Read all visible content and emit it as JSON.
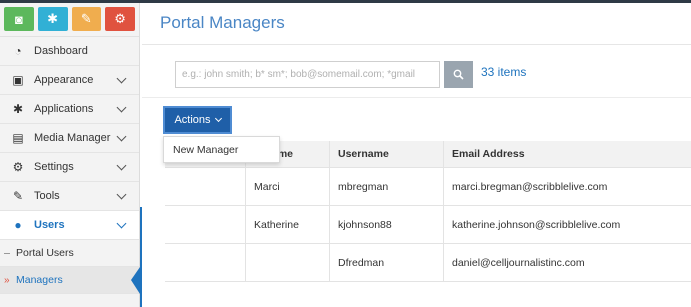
{
  "quick_buttons": [
    {
      "icon": "camera-icon",
      "color": "#5cb85c",
      "glyph": "◙"
    },
    {
      "icon": "asterisk-icon",
      "color": "#31b0d5",
      "glyph": "✱"
    },
    {
      "icon": "wrench-icon",
      "color": "#f0ad4e",
      "glyph": "✎"
    },
    {
      "icon": "cogs-icon",
      "color": "#e0523f",
      "glyph": "⚙"
    }
  ],
  "sidebar": {
    "items": [
      {
        "label": "Dashboard",
        "icon": "dashboard-icon",
        "glyph": "◔"
      },
      {
        "label": "Appearance",
        "icon": "picture-icon",
        "glyph": "▣"
      },
      {
        "label": "Applications",
        "icon": "asterisk-icon",
        "glyph": "✱"
      },
      {
        "label": "Media Manager",
        "icon": "film-icon",
        "glyph": "▤"
      },
      {
        "label": "Settings",
        "icon": "cogs-icon",
        "glyph": "⚙"
      },
      {
        "label": "Tools",
        "icon": "wrench-icon",
        "glyph": "✎"
      },
      {
        "label": "Users",
        "icon": "user-icon",
        "glyph": "●"
      }
    ],
    "sub_items": [
      {
        "label": "Portal Users"
      },
      {
        "label": "Managers",
        "arrow": "»"
      }
    ]
  },
  "main": {
    "title": "Portal Managers",
    "search_placeholder": "e.g.: john smith; b* sm*; bob@somemail.com; *gmail",
    "items_count": "33 items",
    "actions_label": "Actions",
    "dropdown_item": "New Manager"
  },
  "table": {
    "headers": [
      "",
      "Name",
      "Username",
      "Email Address"
    ],
    "header_partial": "ame",
    "rows": [
      [
        "",
        "Marci",
        "mbregman",
        "marci.bregman@scribblelive.com"
      ],
      [
        "",
        "Katherine",
        "kjohnson88",
        "katherine.johnson@scribblelive.com"
      ],
      [
        "",
        "",
        "Dfredman",
        "daniel@celljournalistinc.com"
      ]
    ]
  },
  "colors": {
    "accent": "#1e73be",
    "title": "#4a86c5",
    "actions": "#1f5fa8"
  }
}
